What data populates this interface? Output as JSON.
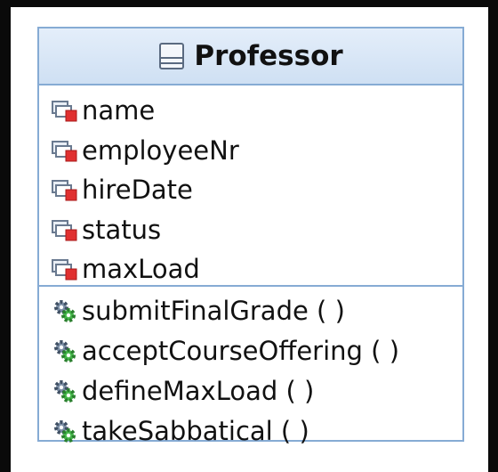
{
  "class": {
    "name": "Professor",
    "icon": "class-icon",
    "accent_color": "#86abd4",
    "attributes": [
      {
        "label": "name",
        "icon": "private-attribute-icon"
      },
      {
        "label": "employeeNr",
        "icon": "private-attribute-icon"
      },
      {
        "label": "hireDate",
        "icon": "private-attribute-icon"
      },
      {
        "label": "status",
        "icon": "private-attribute-icon"
      },
      {
        "label": "maxLoad",
        "icon": "private-attribute-icon"
      }
    ],
    "operations": [
      {
        "label": "submitFinalGrade ( )",
        "icon": "operation-icon"
      },
      {
        "label": "acceptCourseOffering ( )",
        "icon": "operation-icon"
      },
      {
        "label": "defineMaxLoad ( )",
        "icon": "operation-icon"
      },
      {
        "label": "takeSabbatical ( )",
        "icon": "operation-icon"
      }
    ]
  }
}
